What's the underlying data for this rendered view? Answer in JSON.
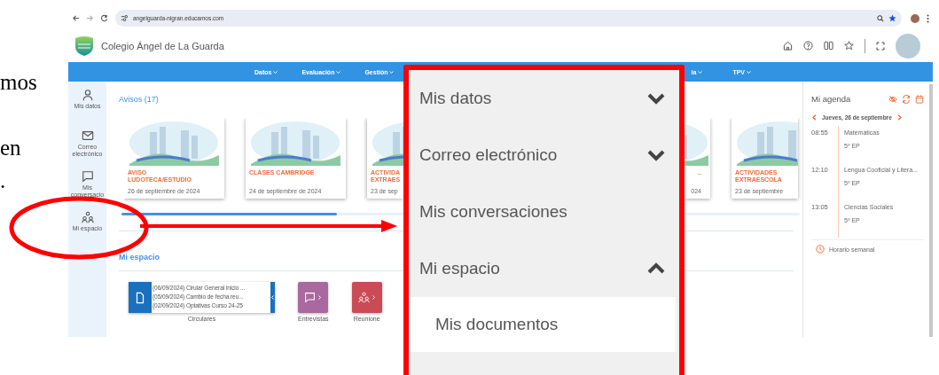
{
  "document_text": [
    "mos",
    "en",
    "."
  ],
  "browser": {
    "url": "angelguarda-nigran.educamos.com"
  },
  "header": {
    "title": "Colegio Ángel de La Guarda"
  },
  "nav": [
    {
      "label": "Datos"
    },
    {
      "label": "Evaluación"
    },
    {
      "label": "Gestión"
    },
    {
      "label": "ia"
    },
    {
      "label": "TPV"
    }
  ],
  "sidebar": [
    {
      "label": "Mis datos"
    },
    {
      "label": "Correo electrónico"
    },
    {
      "label": "Mis conversacio"
    },
    {
      "label": "Mi espacio"
    }
  ],
  "avisos": {
    "title": "Avisos (17)",
    "cards": [
      {
        "title_lines": [
          "AVISO",
          "LUDOTECA/ESTUDIO"
        ],
        "date": "26 de septiembre de 2024"
      },
      {
        "title_lines": [
          "CLASES CAMBRIDGE"
        ],
        "date": "24 de septiembre de 2024"
      },
      {
        "title_lines": [
          "ACTIVIDA",
          "EXTRAES"
        ],
        "date": "23 de sep"
      },
      {
        "title_lines": [
          ".."
        ],
        "date": "024"
      },
      {
        "title_lines": [
          "ACTIVIDADES",
          "EXTRAESCOLA"
        ],
        "date": "23 de septiembre"
      }
    ]
  },
  "mi_espacio": {
    "title": "Mi espacio",
    "widgets": [
      {
        "kind": "list",
        "label": "Circulares",
        "color": "#1b6fbf",
        "items": [
          "(06/09/2024) Cirular General inicio ...",
          "(05/09/2024) Cambio de fecha reu...",
          "(02/09/2024) Optativas Curso 24-25"
        ]
      },
      {
        "kind": "tile",
        "label": "Entrevistas",
        "color": "#a9689f"
      },
      {
        "kind": "tile",
        "label": "Reunione",
        "color": "#c94b55"
      }
    ]
  },
  "agenda": {
    "title": "Mi agenda",
    "date": "Jueves, 26 de septiembre",
    "events": [
      {
        "time": "08:55",
        "subject": "Matemáticas",
        "group": "5º EP"
      },
      {
        "time": "12:10",
        "subject": "Lengua Cooficial y Litera...",
        "group": "5º EP"
      },
      {
        "time": "13:05",
        "subject": "Ciencias Sociales",
        "group": "5º EP"
      }
    ],
    "footer": "Horario semanal"
  },
  "menu": {
    "items": [
      {
        "label": "Mis datos",
        "kind": "group",
        "expanded": false
      },
      {
        "label": "Correo electrónico",
        "kind": "group",
        "expanded": false
      },
      {
        "label": "Mis conversaciones",
        "kind": "link"
      },
      {
        "label": "Mi espacio",
        "kind": "group",
        "expanded": true,
        "children": [
          {
            "label": "Mis documentos"
          }
        ]
      }
    ]
  }
}
